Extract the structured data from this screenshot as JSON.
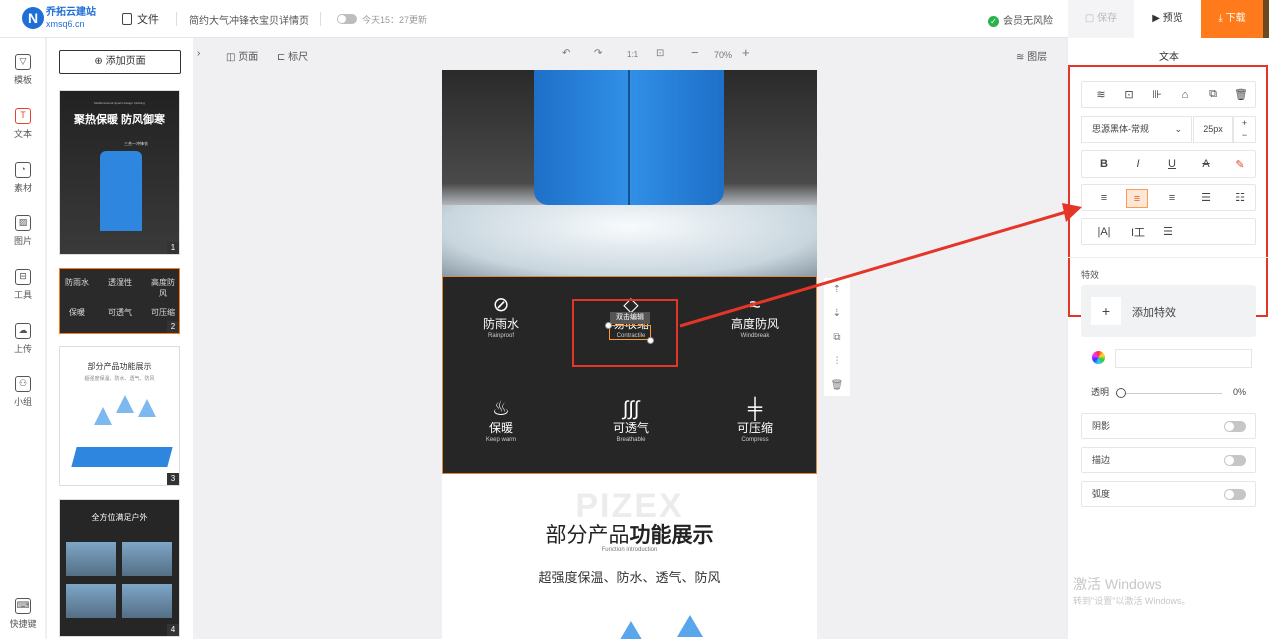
{
  "brand": {
    "logo_letter": "N",
    "name": "乔拓云建站",
    "domain": "xmsq6.cn"
  },
  "toolbar": {
    "file_label": "文件",
    "doc_title": "简约大气冲锋衣宝贝详情页",
    "save_status": "今天15：27更新",
    "member_status": "会员无风险",
    "save_label": "保存",
    "preview_label": "预览",
    "download_label": "下载"
  },
  "leftnav": {
    "items": [
      {
        "label": "模板",
        "icon": "template-icon"
      },
      {
        "label": "文本",
        "icon": "text-icon"
      },
      {
        "label": "素材",
        "icon": "material-icon"
      },
      {
        "label": "图片",
        "icon": "image-icon"
      },
      {
        "label": "工具",
        "icon": "toolbox-icon"
      },
      {
        "label": "上传",
        "icon": "upload-icon"
      },
      {
        "label": "小组",
        "icon": "group-icon"
      }
    ],
    "shortcut_label": "快捷键"
  },
  "pages": {
    "add_label": "添加页面",
    "thumbs": [
      {
        "num": "1",
        "title": "聚热保暖 防风御寒",
        "tiny": "Multifunctional Sports Design Clothing",
        "sub": "三合一冲锋衣"
      },
      {
        "num": "2",
        "items": [
          "防雨水",
          "透湿性",
          "高度防风",
          "保暖",
          "可透气",
          "可压缩"
        ]
      },
      {
        "num": "3",
        "title": "部分产品功能展示",
        "sub": "超强度保温、防水、透气、防风"
      },
      {
        "num": "4",
        "title": "全方位满足户外"
      }
    ]
  },
  "subbar": {
    "page_label": "页面",
    "ruler_label": "标尺",
    "ratio_label": "1:1",
    "zoom": "70%",
    "layers_label": "图层"
  },
  "canvas": {
    "features": [
      {
        "icon": "no-rain-icon",
        "glyph": "⊘",
        "name": "防雨水",
        "en": "Rainproof"
      },
      {
        "icon": "compress-icon",
        "glyph": "◇",
        "name": "易收缩",
        "en": "Contractile"
      },
      {
        "icon": "windbreak-icon",
        "glyph": "≈",
        "name": "高度防风",
        "en": "Windbreak"
      },
      {
        "icon": "flame-icon",
        "glyph": "♨",
        "name": "保暖",
        "en": "Keep warm"
      },
      {
        "icon": "steam-icon",
        "glyph": "∫∫∫",
        "name": "可透气",
        "en": "Breathable"
      },
      {
        "icon": "compressible-icon",
        "glyph": "╪",
        "name": "可压缩",
        "en": "Compress"
      }
    ],
    "edit_tip": "双击编辑",
    "section": {
      "watermark": "PIZEX",
      "title_light": "部分产品",
      "title_bold": "功能展示",
      "title_en": "Function introduction",
      "subtitle": "超强度保温、防水、透气、防风"
    }
  },
  "panel": {
    "title": "文本",
    "font_family": "思源黑体-常规",
    "font_size": "25px",
    "effect_label": "特效",
    "add_effect_label": "添加特效",
    "opacity_label": "透明",
    "opacity_value": "0%",
    "opacity": 0,
    "shadow_label": "阴影",
    "stroke_label": "描边",
    "arc_label": "弧度"
  },
  "os": {
    "activate_title": "激活 Windows",
    "activate_sub": "转到\"设置\"以激活 Windows。"
  },
  "colors": {
    "accent": "#ff7a1a",
    "highlight": "#e53526",
    "brand": "#1f6fd6",
    "jacket": "#2e86de"
  }
}
